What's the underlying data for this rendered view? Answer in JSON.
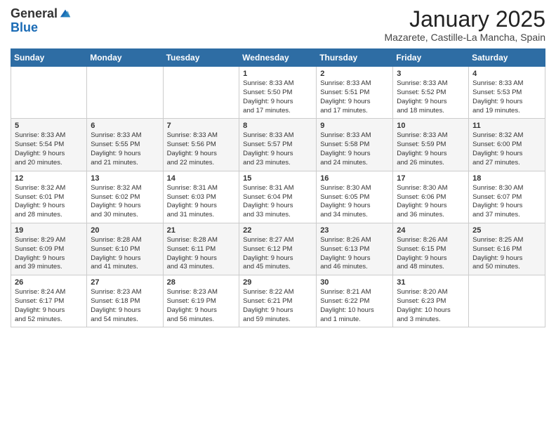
{
  "logo": {
    "general": "General",
    "blue": "Blue"
  },
  "header": {
    "month": "January 2025",
    "location": "Mazarete, Castille-La Mancha, Spain"
  },
  "weekdays": [
    "Sunday",
    "Monday",
    "Tuesday",
    "Wednesday",
    "Thursday",
    "Friday",
    "Saturday"
  ],
  "weeks": [
    [
      {
        "day": "",
        "info": ""
      },
      {
        "day": "",
        "info": ""
      },
      {
        "day": "",
        "info": ""
      },
      {
        "day": "1",
        "info": "Sunrise: 8:33 AM\nSunset: 5:50 PM\nDaylight: 9 hours\nand 17 minutes."
      },
      {
        "day": "2",
        "info": "Sunrise: 8:33 AM\nSunset: 5:51 PM\nDaylight: 9 hours\nand 17 minutes."
      },
      {
        "day": "3",
        "info": "Sunrise: 8:33 AM\nSunset: 5:52 PM\nDaylight: 9 hours\nand 18 minutes."
      },
      {
        "day": "4",
        "info": "Sunrise: 8:33 AM\nSunset: 5:53 PM\nDaylight: 9 hours\nand 19 minutes."
      }
    ],
    [
      {
        "day": "5",
        "info": "Sunrise: 8:33 AM\nSunset: 5:54 PM\nDaylight: 9 hours\nand 20 minutes."
      },
      {
        "day": "6",
        "info": "Sunrise: 8:33 AM\nSunset: 5:55 PM\nDaylight: 9 hours\nand 21 minutes."
      },
      {
        "day": "7",
        "info": "Sunrise: 8:33 AM\nSunset: 5:56 PM\nDaylight: 9 hours\nand 22 minutes."
      },
      {
        "day": "8",
        "info": "Sunrise: 8:33 AM\nSunset: 5:57 PM\nDaylight: 9 hours\nand 23 minutes."
      },
      {
        "day": "9",
        "info": "Sunrise: 8:33 AM\nSunset: 5:58 PM\nDaylight: 9 hours\nand 24 minutes."
      },
      {
        "day": "10",
        "info": "Sunrise: 8:33 AM\nSunset: 5:59 PM\nDaylight: 9 hours\nand 26 minutes."
      },
      {
        "day": "11",
        "info": "Sunrise: 8:32 AM\nSunset: 6:00 PM\nDaylight: 9 hours\nand 27 minutes."
      }
    ],
    [
      {
        "day": "12",
        "info": "Sunrise: 8:32 AM\nSunset: 6:01 PM\nDaylight: 9 hours\nand 28 minutes."
      },
      {
        "day": "13",
        "info": "Sunrise: 8:32 AM\nSunset: 6:02 PM\nDaylight: 9 hours\nand 30 minutes."
      },
      {
        "day": "14",
        "info": "Sunrise: 8:31 AM\nSunset: 6:03 PM\nDaylight: 9 hours\nand 31 minutes."
      },
      {
        "day": "15",
        "info": "Sunrise: 8:31 AM\nSunset: 6:04 PM\nDaylight: 9 hours\nand 33 minutes."
      },
      {
        "day": "16",
        "info": "Sunrise: 8:30 AM\nSunset: 6:05 PM\nDaylight: 9 hours\nand 34 minutes."
      },
      {
        "day": "17",
        "info": "Sunrise: 8:30 AM\nSunset: 6:06 PM\nDaylight: 9 hours\nand 36 minutes."
      },
      {
        "day": "18",
        "info": "Sunrise: 8:30 AM\nSunset: 6:07 PM\nDaylight: 9 hours\nand 37 minutes."
      }
    ],
    [
      {
        "day": "19",
        "info": "Sunrise: 8:29 AM\nSunset: 6:09 PM\nDaylight: 9 hours\nand 39 minutes."
      },
      {
        "day": "20",
        "info": "Sunrise: 8:28 AM\nSunset: 6:10 PM\nDaylight: 9 hours\nand 41 minutes."
      },
      {
        "day": "21",
        "info": "Sunrise: 8:28 AM\nSunset: 6:11 PM\nDaylight: 9 hours\nand 43 minutes."
      },
      {
        "day": "22",
        "info": "Sunrise: 8:27 AM\nSunset: 6:12 PM\nDaylight: 9 hours\nand 45 minutes."
      },
      {
        "day": "23",
        "info": "Sunrise: 8:26 AM\nSunset: 6:13 PM\nDaylight: 9 hours\nand 46 minutes."
      },
      {
        "day": "24",
        "info": "Sunrise: 8:26 AM\nSunset: 6:15 PM\nDaylight: 9 hours\nand 48 minutes."
      },
      {
        "day": "25",
        "info": "Sunrise: 8:25 AM\nSunset: 6:16 PM\nDaylight: 9 hours\nand 50 minutes."
      }
    ],
    [
      {
        "day": "26",
        "info": "Sunrise: 8:24 AM\nSunset: 6:17 PM\nDaylight: 9 hours\nand 52 minutes."
      },
      {
        "day": "27",
        "info": "Sunrise: 8:23 AM\nSunset: 6:18 PM\nDaylight: 9 hours\nand 54 minutes."
      },
      {
        "day": "28",
        "info": "Sunrise: 8:23 AM\nSunset: 6:19 PM\nDaylight: 9 hours\nand 56 minutes."
      },
      {
        "day": "29",
        "info": "Sunrise: 8:22 AM\nSunset: 6:21 PM\nDaylight: 9 hours\nand 59 minutes."
      },
      {
        "day": "30",
        "info": "Sunrise: 8:21 AM\nSunset: 6:22 PM\nDaylight: 10 hours\nand 1 minute."
      },
      {
        "day": "31",
        "info": "Sunrise: 8:20 AM\nSunset: 6:23 PM\nDaylight: 10 hours\nand 3 minutes."
      },
      {
        "day": "",
        "info": ""
      }
    ]
  ]
}
